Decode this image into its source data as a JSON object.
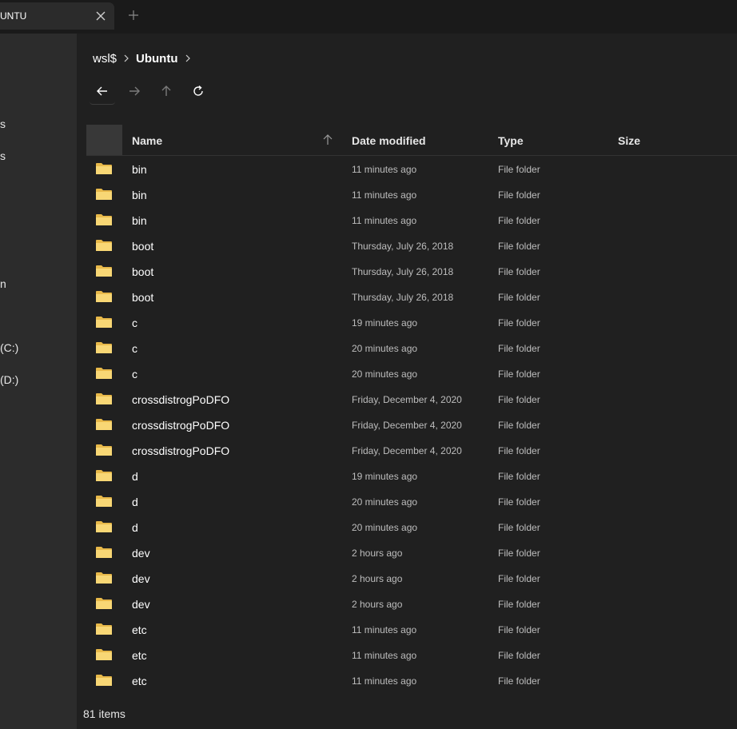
{
  "tab": {
    "title": "UNTU"
  },
  "sidebar": {
    "items": [
      {
        "label": "s"
      },
      {
        "label": "s"
      },
      {
        "label": "n"
      },
      {
        "label": "(C:)"
      },
      {
        "label": "(D:)"
      }
    ]
  },
  "breadcrumb": {
    "items": [
      "wsl$",
      "Ubuntu"
    ]
  },
  "columns": {
    "name": "Name",
    "date": "Date modified",
    "type": "Type",
    "size": "Size"
  },
  "files": [
    {
      "name": "bin",
      "date": "11 minutes ago",
      "type": "File folder"
    },
    {
      "name": "bin",
      "date": "11 minutes ago",
      "type": "File folder"
    },
    {
      "name": "bin",
      "date": "11 minutes ago",
      "type": "File folder"
    },
    {
      "name": "boot",
      "date": "Thursday, July 26, 2018",
      "type": "File folder"
    },
    {
      "name": "boot",
      "date": "Thursday, July 26, 2018",
      "type": "File folder"
    },
    {
      "name": "boot",
      "date": "Thursday, July 26, 2018",
      "type": "File folder"
    },
    {
      "name": "c",
      "date": "19 minutes ago",
      "type": "File folder"
    },
    {
      "name": "c",
      "date": "20 minutes ago",
      "type": "File folder"
    },
    {
      "name": "c",
      "date": "20 minutes ago",
      "type": "File folder"
    },
    {
      "name": "crossdistrogPoDFO",
      "date": "Friday, December 4, 2020",
      "type": "File folder"
    },
    {
      "name": "crossdistrogPoDFO",
      "date": "Friday, December 4, 2020",
      "type": "File folder"
    },
    {
      "name": "crossdistrogPoDFO",
      "date": "Friday, December 4, 2020",
      "type": "File folder"
    },
    {
      "name": "d",
      "date": "19 minutes ago",
      "type": "File folder"
    },
    {
      "name": "d",
      "date": "20 minutes ago",
      "type": "File folder"
    },
    {
      "name": "d",
      "date": "20 minutes ago",
      "type": "File folder"
    },
    {
      "name": "dev",
      "date": "2 hours ago",
      "type": "File folder"
    },
    {
      "name": "dev",
      "date": "2 hours ago",
      "type": "File folder"
    },
    {
      "name": "dev",
      "date": "2 hours ago",
      "type": "File folder"
    },
    {
      "name": "etc",
      "date": "11 minutes ago",
      "type": "File folder"
    },
    {
      "name": "etc",
      "date": "11 minutes ago",
      "type": "File folder"
    },
    {
      "name": "etc",
      "date": "11 minutes ago",
      "type": "File folder"
    }
  ],
  "status": {
    "item_count": "81 items"
  },
  "colors": {
    "folder": "#f8d775",
    "folder_dark": "#e8b94a",
    "background": "#202020",
    "sidebar": "#2c2c2c"
  },
  "icons": {
    "back": "arrow-left-icon",
    "forward": "arrow-right-icon",
    "up": "arrow-up-icon",
    "refresh": "refresh-icon",
    "folder": "folder-icon",
    "close": "close-icon",
    "add": "plus-icon",
    "sort": "sort-ascending-icon",
    "separator": "chevron-right-icon"
  }
}
